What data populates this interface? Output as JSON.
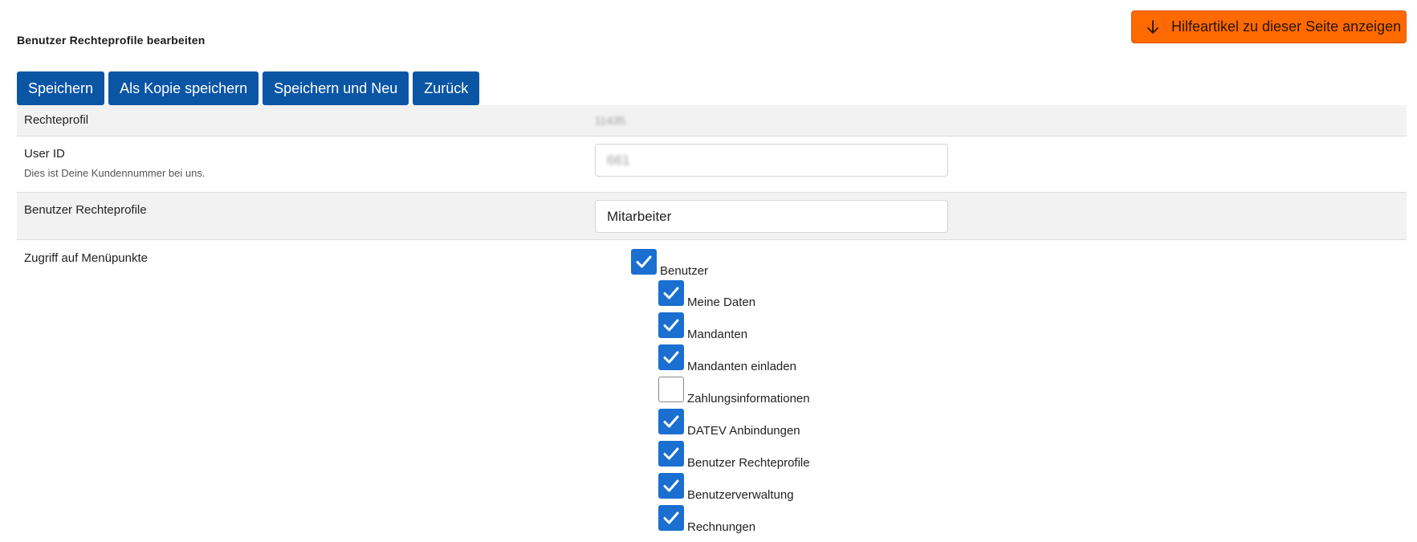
{
  "page": {
    "title": "Benutzer Rechteprofile bearbeiten",
    "help_button": "Hilfeartikel zu dieser Seite anzeigen"
  },
  "toolbar": {
    "save": "Speichern",
    "save_copy": "Als Kopie speichern",
    "save_new": "Speichern und Neu",
    "back": "Zurück"
  },
  "form": {
    "rechteprofil": {
      "label": "Rechteprofil",
      "value": "11435"
    },
    "user_id": {
      "label": "User ID",
      "hint": "Dies ist Deine Kundennummer bei uns.",
      "value": "661"
    },
    "profile_name": {
      "label": "Benutzer Rechteprofile",
      "value": "Mitarbeiter"
    },
    "menu_access": {
      "label": "Zugriff auf Menüpunkte",
      "parent": {
        "label": "Benutzer",
        "checked": true
      },
      "children": [
        {
          "label": "Meine Daten",
          "checked": true
        },
        {
          "label": "Mandanten",
          "checked": true
        },
        {
          "label": "Mandanten einladen",
          "checked": true
        },
        {
          "label": "Zahlungsinformationen",
          "checked": false
        },
        {
          "label": "DATEV Anbindungen",
          "checked": true
        },
        {
          "label": "Benutzer Rechteprofile",
          "checked": true
        },
        {
          "label": "Benutzerverwaltung",
          "checked": true
        },
        {
          "label": "Rechnungen",
          "checked": true
        }
      ]
    }
  },
  "colors": {
    "primary_button": "#0b55a5",
    "help_button": "#ff6a00",
    "checkbox_checked": "#1a6fd0"
  }
}
